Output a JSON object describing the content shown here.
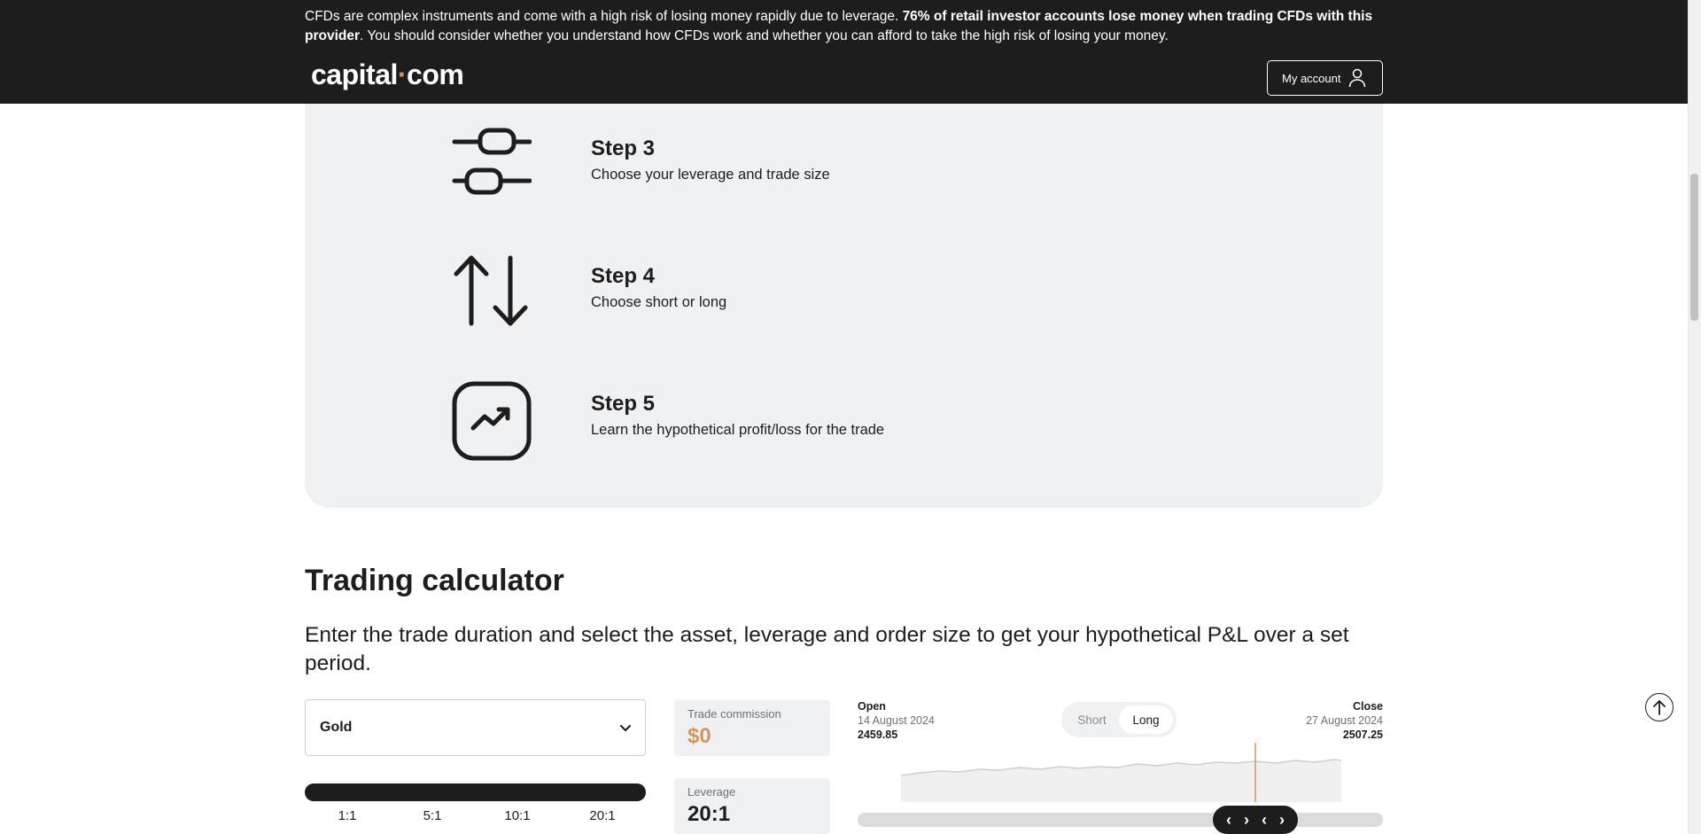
{
  "header": {
    "risk_part1": "CFDs are complex instruments and come with a high risk of losing money rapidly due to leverage. ",
    "risk_bold": "76% of retail investor accounts lose money when trading CFDs with this provider",
    "risk_part2": ". You should consider whether you understand how CFDs work and whether you can afford to take the high risk of losing your money.",
    "logo_left": "capital",
    "logo_dot": "·",
    "logo_right": "com",
    "account_label": "My account"
  },
  "steps": [
    {
      "title": "Step 3",
      "desc": "Choose your leverage and trade size",
      "icon": "sliders-icon"
    },
    {
      "title": "Step 4",
      "desc": "Choose short or long",
      "icon": "up-down-arrows-icon"
    },
    {
      "title": "Step 5",
      "desc": "Learn the hypothetical profit/loss for the trade",
      "icon": "trend-up-icon"
    }
  ],
  "calculator": {
    "title": "Trading calculator",
    "subtitle": "Enter the trade duration and select the asset, leverage and order size to get your hypothetical P&L over a set period.",
    "asset": "Gold",
    "leverage_ticks": [
      "1:1",
      "5:1",
      "10:1",
      "20:1"
    ],
    "leverage_selected_fraction": 1.0,
    "commission_label": "Trade commission",
    "commission_value": "$0",
    "leverage_label": "Leverage",
    "leverage_value": "20:1",
    "open_label": "Open",
    "open_date": "14 August 2024",
    "open_price": "2459.85",
    "close_label": "Close",
    "close_date": "27 August 2024",
    "close_price": "2507.25",
    "direction_options": [
      "Short",
      "Long"
    ],
    "direction_selected": "Long",
    "accent_color": "#d6955c"
  }
}
